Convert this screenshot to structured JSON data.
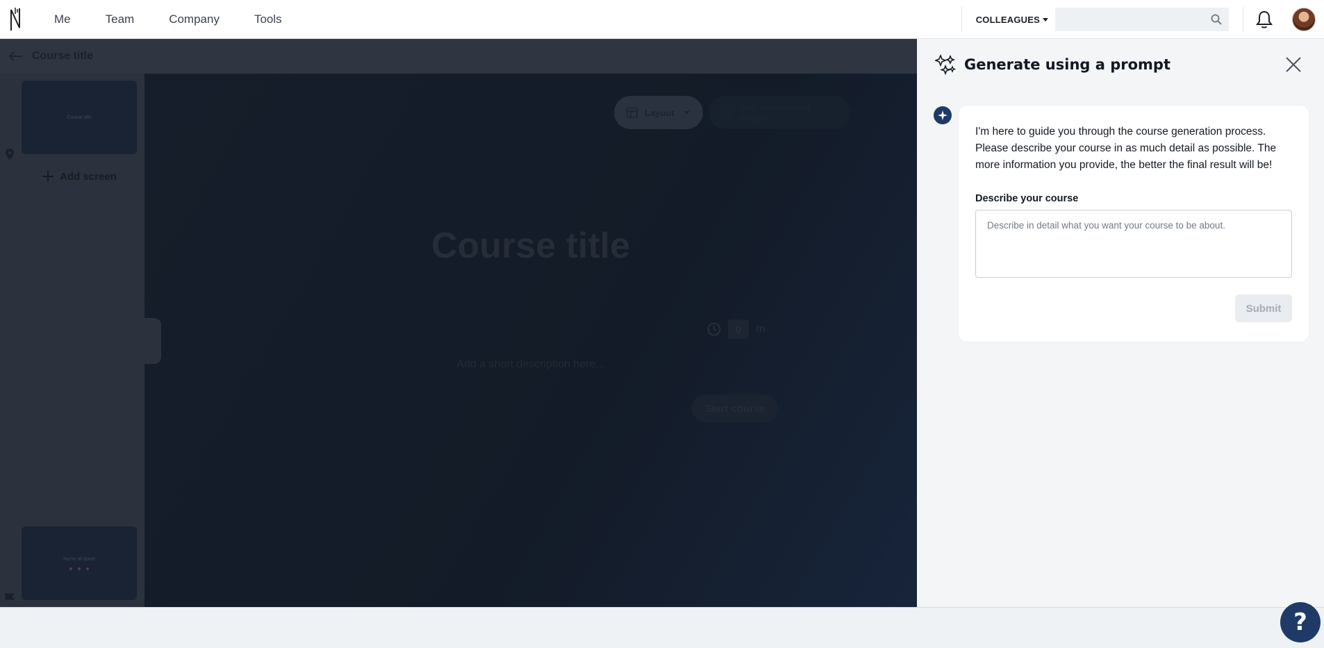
{
  "nav": {
    "items": [
      {
        "label": "Me"
      },
      {
        "label": "Team"
      },
      {
        "label": "Company"
      },
      {
        "label": "Tools"
      }
    ],
    "colleagues_label": "COLLEAGUES",
    "search_placeholder": ""
  },
  "editor": {
    "header_title": "Course title",
    "add_screen_label": "Add screen",
    "thumb1_text": "Course title",
    "thumb2_text": "You're all done!",
    "layout_label": "Layout",
    "add_bg_label": "Add background image",
    "canvas_title": "Course title",
    "duration_value": "0",
    "duration_unit": "m",
    "short_description": "Add a short description here...",
    "start_button": "Start course"
  },
  "panel": {
    "title": "Generate using a prompt",
    "message": "I'm here to guide you through the course generation process. Please describe your course in as much detail as possible. The more information you provide, the better the final result will be!",
    "field_label": "Describe your course",
    "field_placeholder": "Describe in detail what you want your course to be about.",
    "field_value": "",
    "submit_label": "Submit"
  },
  "help": {
    "label": "?"
  },
  "colors": {
    "accent": "#1f3a66",
    "overlay": "#2b323d",
    "panel_bg": "#f3f5f7"
  },
  "icons": [
    "logo-icon",
    "caret-down-icon",
    "search-icon",
    "bell-icon",
    "back-arrow-icon",
    "pin-icon",
    "flag-icon",
    "plus-icon",
    "layout-icon",
    "image-icon",
    "clock-icon",
    "sparkle-icon",
    "close-icon",
    "help-icon"
  ]
}
